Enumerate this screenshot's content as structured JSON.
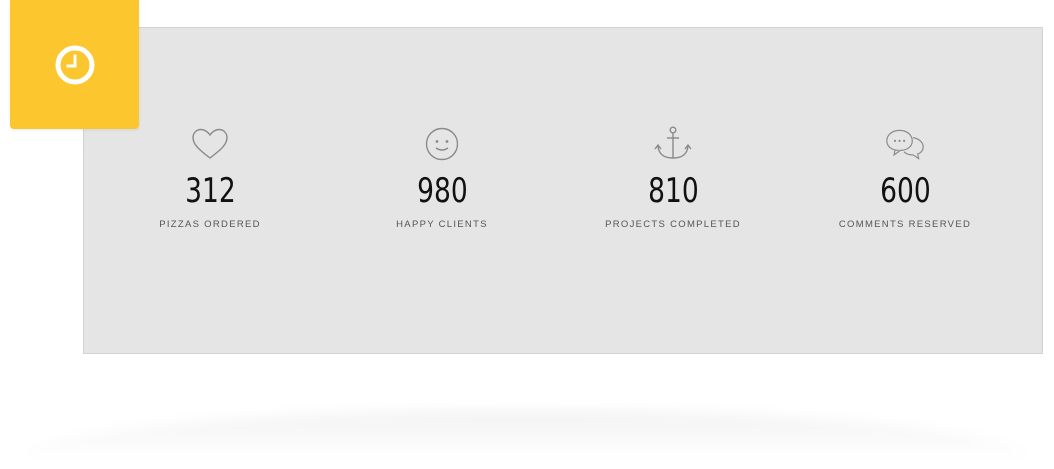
{
  "badge": {
    "icon": "clock-icon",
    "color": "#fcc72e"
  },
  "stats": [
    {
      "icon": "heart-icon",
      "value": "312",
      "label": "PIZZAS ORDERED"
    },
    {
      "icon": "smiley-icon",
      "value": "980",
      "label": "HAPPY CLIENTS"
    },
    {
      "icon": "anchor-icon",
      "value": "810",
      "label": "PROJECTS COMPLETED"
    },
    {
      "icon": "chat-bubbles-icon",
      "value": "600",
      "label": "COMMENTS RESERVED"
    }
  ]
}
